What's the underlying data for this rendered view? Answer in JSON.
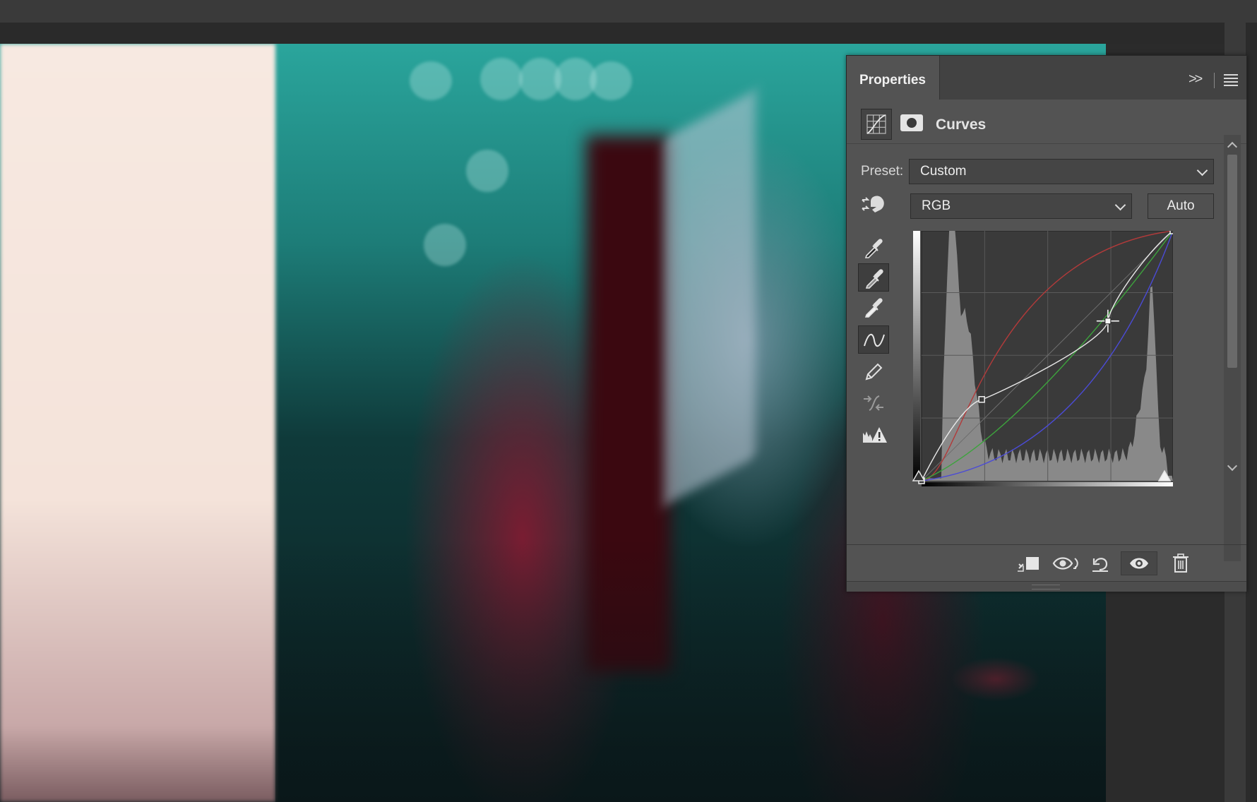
{
  "panel": {
    "tab_title": "Properties",
    "adjustment_title": "Curves",
    "preset_label": "Preset:",
    "preset_value": "Custom",
    "channel_value": "RGB",
    "auto_label": "Auto"
  },
  "colors": {
    "panel_bg": "#535353",
    "curve_red": "#b23a3a",
    "curve_green": "#3da33d",
    "curve_blue": "#4b4bd6",
    "curve_rgb": "#e8e8e8"
  },
  "icons": {
    "tab_collapse": "double-chevron-right-icon",
    "panel_menu": "hamburger-menu-icon",
    "curves_layer": "curves-layer-icon",
    "mask": "mask-icon",
    "on_image_adjust": "hand-adjust-icon",
    "black_point": "eyedropper-black-icon",
    "gray_point": "eyedropper-gray-icon",
    "white_point": "eyedropper-white-icon",
    "curve_points": "curve-points-icon",
    "pencil": "pencil-icon",
    "smooth": "smooth-curve-icon",
    "clipping": "clipping-warning-icon",
    "clip_to_layer": "clip-to-layer-icon",
    "view_previous": "view-previous-state-icon",
    "reset": "reset-icon",
    "visibility": "eye-icon",
    "delete": "trash-icon"
  }
}
